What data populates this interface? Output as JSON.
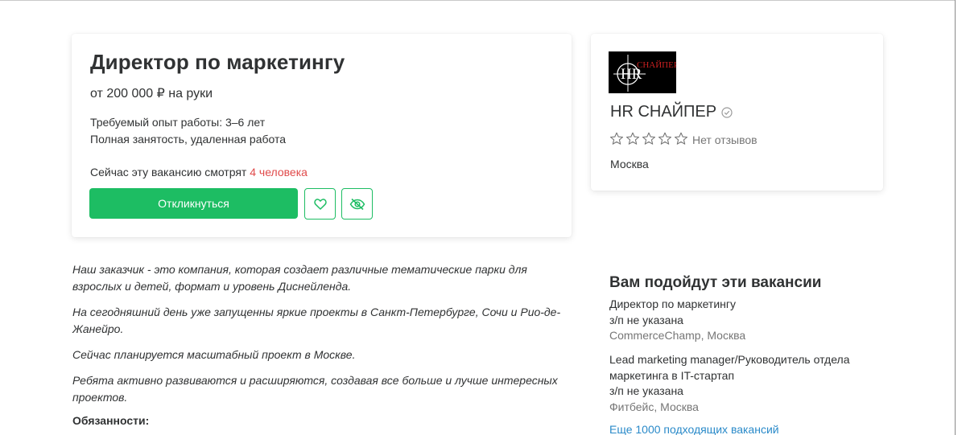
{
  "vacancy": {
    "title": "Директор по маркетингу",
    "salary": "от 200 000 ₽ на руки",
    "experience": "Требуемый опыт работы: 3–6 лет",
    "employment": "Полная занятость, удаленная работа",
    "viewers_prefix": "Сейчас эту вакансию смотрят ",
    "viewers_count": "4 человека",
    "apply_label": "Откликнуться",
    "favorite_icon": "heart-icon",
    "hide_icon": "eye-off-icon",
    "accent_color": "#1dbd63",
    "viewers_color": "#e04a4a"
  },
  "company": {
    "logo_text": "СНАЙПЕР",
    "logo_initials": "HR",
    "name": "HR СНАЙПЕР",
    "rating_stars": 0,
    "reviews_label": "Нет отзывов",
    "city": "Москва"
  },
  "description": {
    "paragraphs": [
      "Наш заказчик - это компания, которая создает различные тематические парки для взрослых и детей, формат и уровень Диснейленда.",
      "На сегодняшний день уже запущенны яркие проекты в Санкт-Петербурге, Сочи и Рио-де-Жанейро.",
      "Сейчас планируется масштабный проект в Москве.",
      "Ребята активно развиваются и расширяются, создавая все больше и лучше интересных проектов."
    ],
    "duties_heading": "Обязанности:"
  },
  "suggestions": {
    "heading": "Вам подойдут эти вакансии",
    "items": [
      {
        "title": "Директор по маркетингу",
        "salary": "з/п не указана",
        "company_city": "CommerceChamp, Москва"
      },
      {
        "title": "Lead marketing manager/Руководитель отдела маркетинга в IT-стартап",
        "salary": "з/п не указана",
        "company_city": "Фитбейс, Москва"
      }
    ],
    "more_link": "Еще 1000 подходящих вакансий",
    "link_color": "#2a8ac9"
  }
}
